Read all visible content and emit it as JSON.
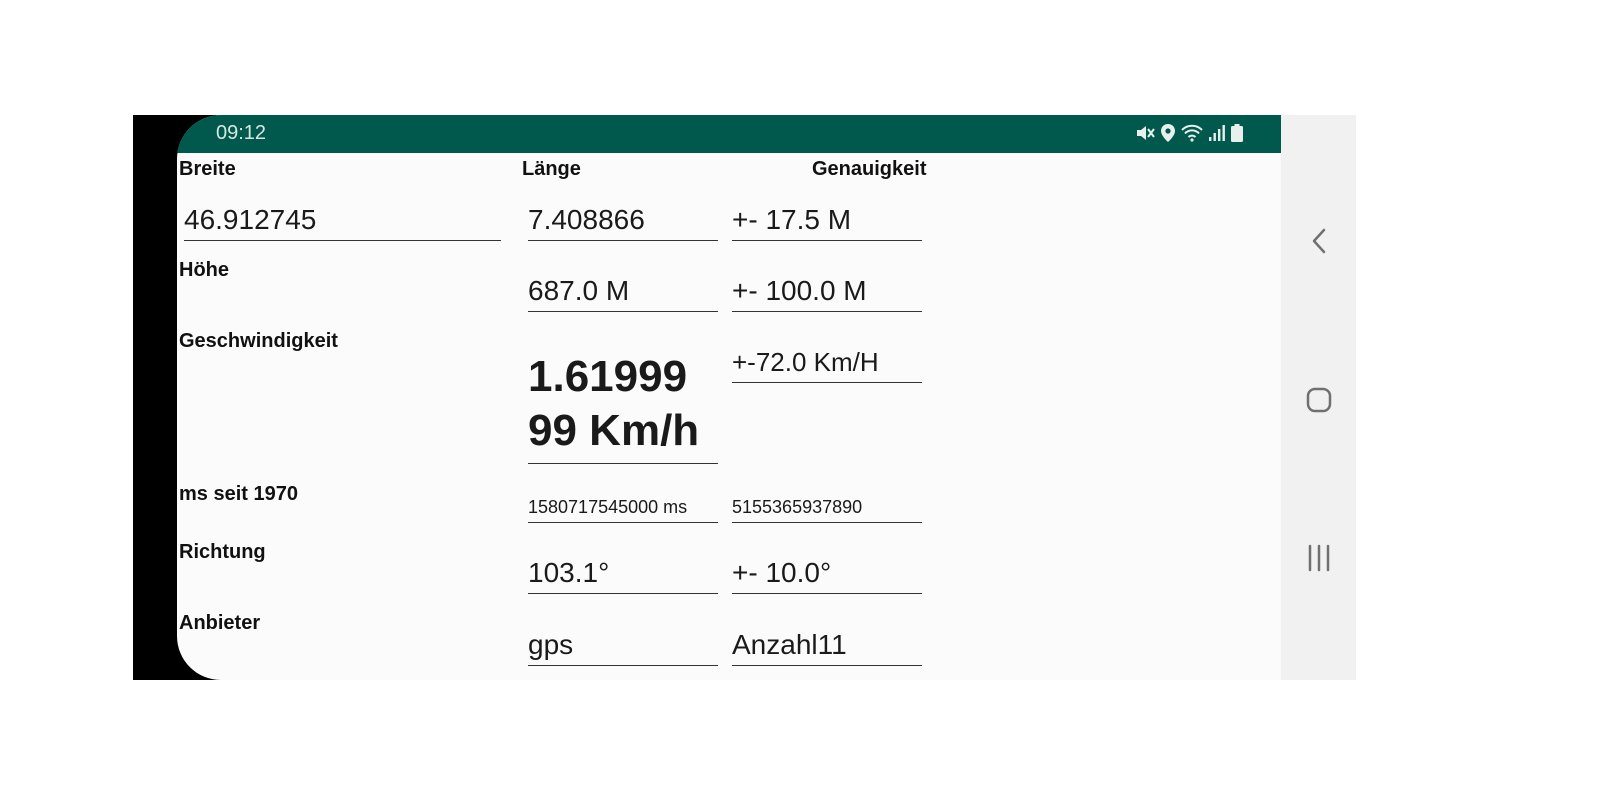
{
  "status_bar": {
    "time": "09:12",
    "icons": [
      "mute-icon",
      "location-icon",
      "wifi-icon",
      "signal-icon",
      "battery-icon"
    ]
  },
  "headers": {
    "breite": "Breite",
    "laenge": "Länge",
    "genauigkeit": "Genauigkeit"
  },
  "rows": {
    "position": {
      "latitude": "46.912745",
      "longitude": "7.408866",
      "accuracy": "+- 17.5 M"
    },
    "altitude": {
      "label": "Höhe",
      "value": "687.0 M",
      "accuracy": "+- 100.0 M"
    },
    "speed": {
      "label": "Geschwindigkeit",
      "value_line1": "1.61999",
      "value_line2": "99 Km/h",
      "accuracy": "+-72.0 Km/H"
    },
    "time": {
      "label": "ms seit 1970",
      "value": "1580717545000 ms",
      "extra": "5155365937890"
    },
    "direction": {
      "label": "Richtung",
      "value": "103.1°",
      "accuracy": "+- 10.0°"
    },
    "provider": {
      "label": "Anbieter",
      "value": "gps",
      "satellites": "Anzahl11"
    }
  },
  "nav": {
    "back": "back-icon",
    "home": "home-icon",
    "recents": "recents-icon"
  },
  "colors": {
    "status_bar": "#00594c",
    "background": "#fbfbfb",
    "nav_bar": "#f1f1f1"
  }
}
